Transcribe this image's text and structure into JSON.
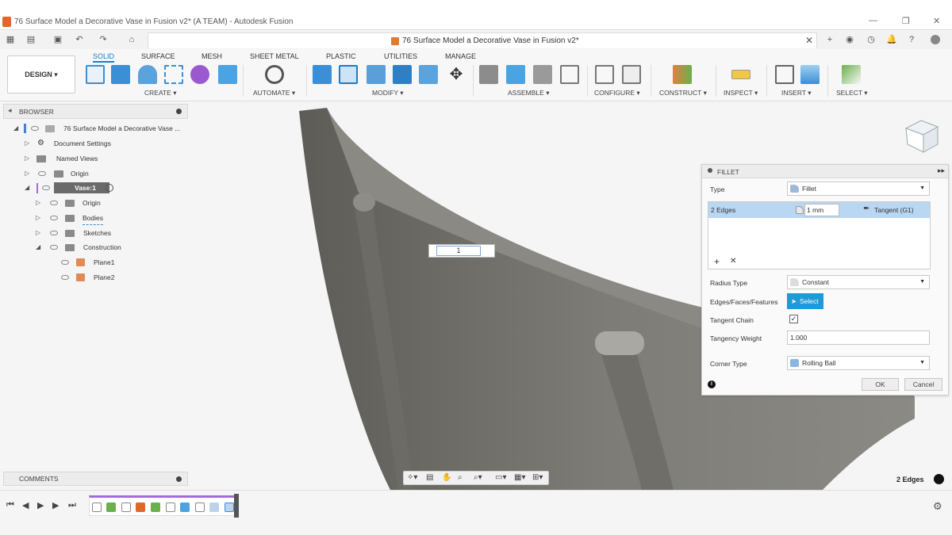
{
  "window": {
    "title": "76 Surface Model a Decorative Vase in Fusion v2* (A TEAM) - Autodesk Fusion"
  },
  "document_tab": {
    "title": "76 Surface Model a Decorative Vase in Fusion v2*"
  },
  "toolbar": {
    "design_label": "DESIGN",
    "workspace_tabs": [
      "SOLID",
      "SURFACE",
      "MESH",
      "SHEET METAL",
      "PLASTIC",
      "UTILITIES",
      "MANAGE"
    ],
    "groups": [
      "CREATE",
      "AUTOMATE",
      "MODIFY",
      "ASSEMBLE",
      "CONFIGURE",
      "CONSTRUCT",
      "INSPECT",
      "INSERT",
      "SELECT"
    ]
  },
  "browser": {
    "title": "BROWSER",
    "items": [
      {
        "label": "76 Surface Model a Decorative Vase ..."
      },
      {
        "label": "Document Settings"
      },
      {
        "label": "Named Views"
      },
      {
        "label": "Origin"
      },
      {
        "label": "Vase:1"
      },
      {
        "label": "Origin"
      },
      {
        "label": "Bodies"
      },
      {
        "label": "Sketches"
      },
      {
        "label": "Construction"
      },
      {
        "label": "Plane1"
      },
      {
        "label": "Plane2"
      }
    ]
  },
  "comments": {
    "title": "COMMENTS"
  },
  "viewport": {
    "inline_value": "1"
  },
  "fillet": {
    "title": "FILLET",
    "type_label": "Type",
    "type_value": "Fillet",
    "selection_label": "2 Edges",
    "radius_value": "1 mm",
    "continuity_value": "Tangent (G1)",
    "radius_type_label": "Radius Type",
    "radius_type_value": "Constant",
    "edges_label": "Edges/Faces/Features",
    "select_button": "Select",
    "tangent_chain_label": "Tangent Chain",
    "tangency_weight_label": "Tangency Weight",
    "tangency_weight_value": "1.000",
    "corner_type_label": "Corner Type",
    "corner_type_value": "Rolling Ball",
    "ok_label": "OK",
    "cancel_label": "Cancel"
  },
  "status": {
    "selection": "2 Edges"
  },
  "colors": {
    "accent": "#1a7ec8",
    "select_btn": "#1e9bd7",
    "highlight_row": "#b9d6f2",
    "model": "#7e7d77"
  }
}
